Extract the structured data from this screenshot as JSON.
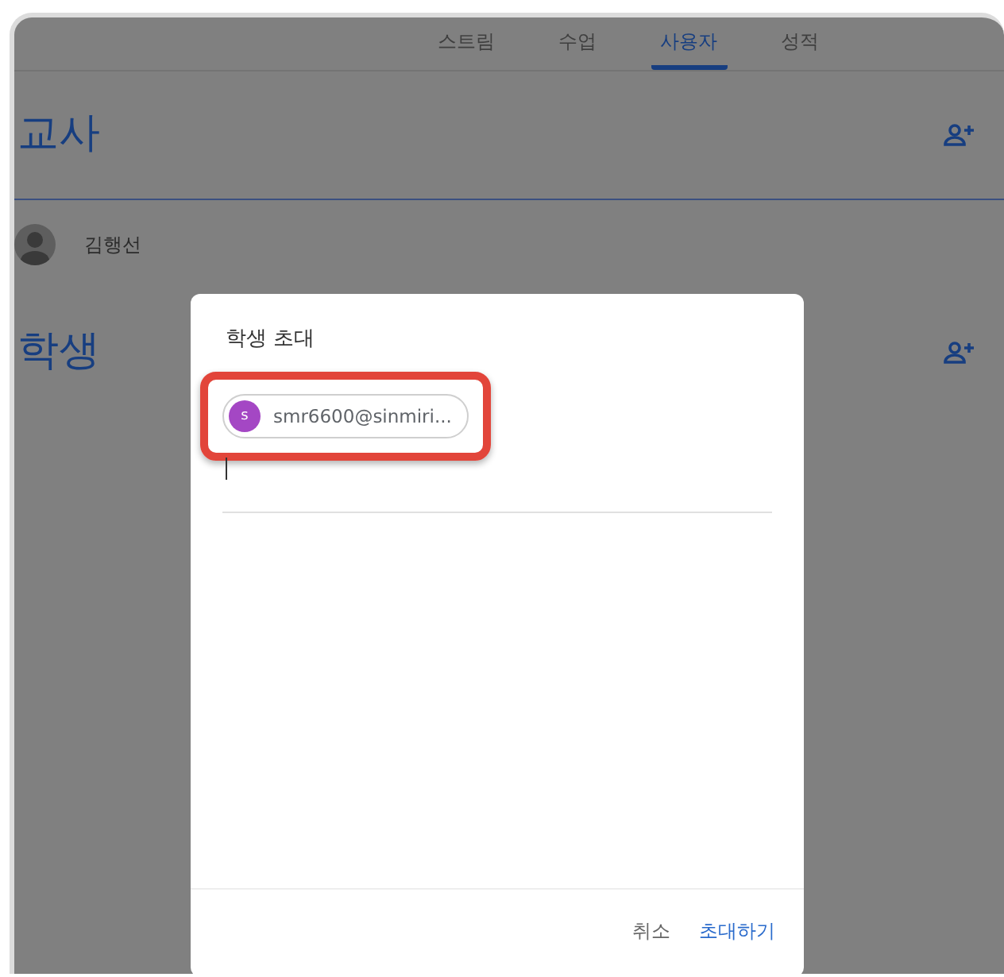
{
  "tabs": [
    {
      "label": "스트림",
      "selected": false
    },
    {
      "label": "수업",
      "selected": false
    },
    {
      "label": "사용자",
      "selected": true
    },
    {
      "label": "성적",
      "selected": false
    }
  ],
  "sections": [
    {
      "title": "교사",
      "people": [
        {
          "name": "김행선"
        }
      ]
    },
    {
      "title": "학생"
    }
  ],
  "dialog": {
    "title": "학생 초대",
    "chips": [
      {
        "initial": "s",
        "email": "smr6600@sinmiri...",
        "color": "#a447c4",
        "highlighted": true
      }
    ],
    "buttons": [
      {
        "label": "취소",
        "kind": "cancel"
      },
      {
        "label": "초대하기",
        "kind": "primary"
      }
    ]
  }
}
